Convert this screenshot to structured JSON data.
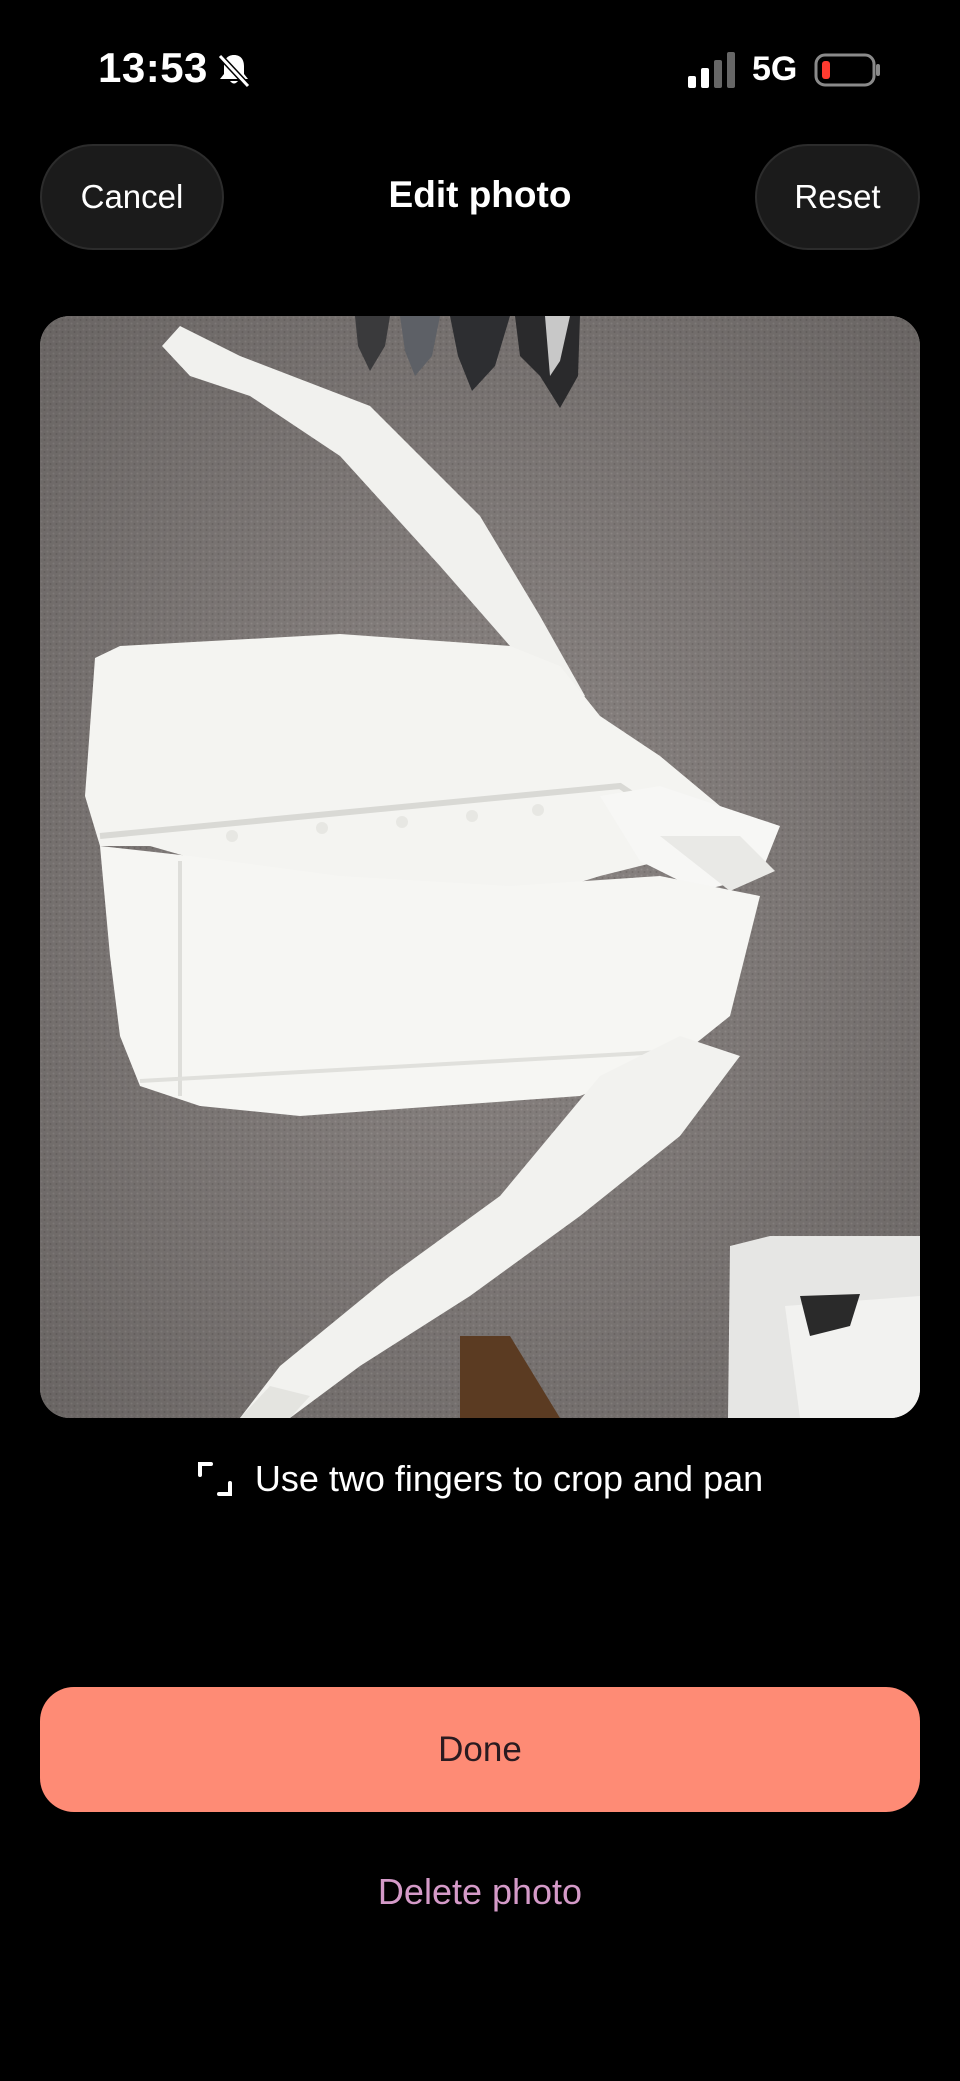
{
  "status_bar": {
    "time": "13:53",
    "network": "5G",
    "icons": [
      "bell-slash-icon",
      "signal-icon",
      "battery-icon"
    ],
    "battery_color": "#ff3b30"
  },
  "header": {
    "cancel_label": "Cancel",
    "title": "Edit photo",
    "reset_label": "Reset"
  },
  "photo": {
    "subject": "white dress shirt laid flat on grey carpet"
  },
  "hint": {
    "icon": "crop-icon",
    "text": "Use two fingers to crop and pan"
  },
  "actions": {
    "done_label": "Done",
    "delete_label": "Delete photo"
  },
  "colors": {
    "background": "#000000",
    "done_button": "#fe8b75",
    "delete_text": "#d49ac8",
    "pill_button": "#1b1b1b"
  }
}
